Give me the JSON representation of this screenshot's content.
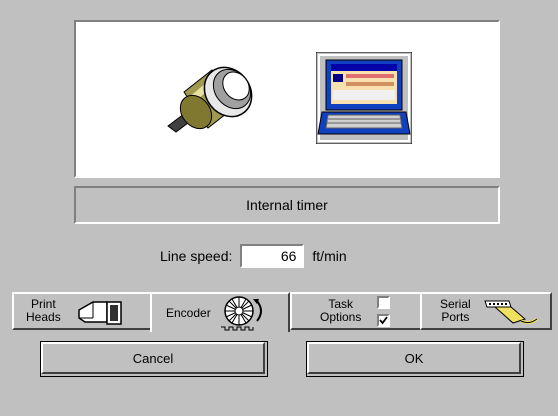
{
  "preview": {
    "encoder_icon": "encoder-shaft-icon",
    "computer_icon": "laptop-computer-icon"
  },
  "mode_label": "Internal timer",
  "line_speed": {
    "label": "Line speed:",
    "value": "66",
    "unit": "ft/min"
  },
  "tabs": [
    {
      "line1": "Print",
      "line2": "Heads",
      "icon": "print-head-icon"
    },
    {
      "line1": "Encoder",
      "icon": "encoder-wheel-icon",
      "active": true
    },
    {
      "line1": "Task",
      "line2": "Options",
      "icon": "checkbox-icon"
    },
    {
      "line1": "Serial",
      "line2": "Ports",
      "icon": "serial-cable-icon"
    }
  ],
  "buttons": {
    "cancel": "Cancel",
    "ok": "OK"
  },
  "colors": {
    "background": "#c0c0c0",
    "screen_blue": "#0000a8"
  }
}
